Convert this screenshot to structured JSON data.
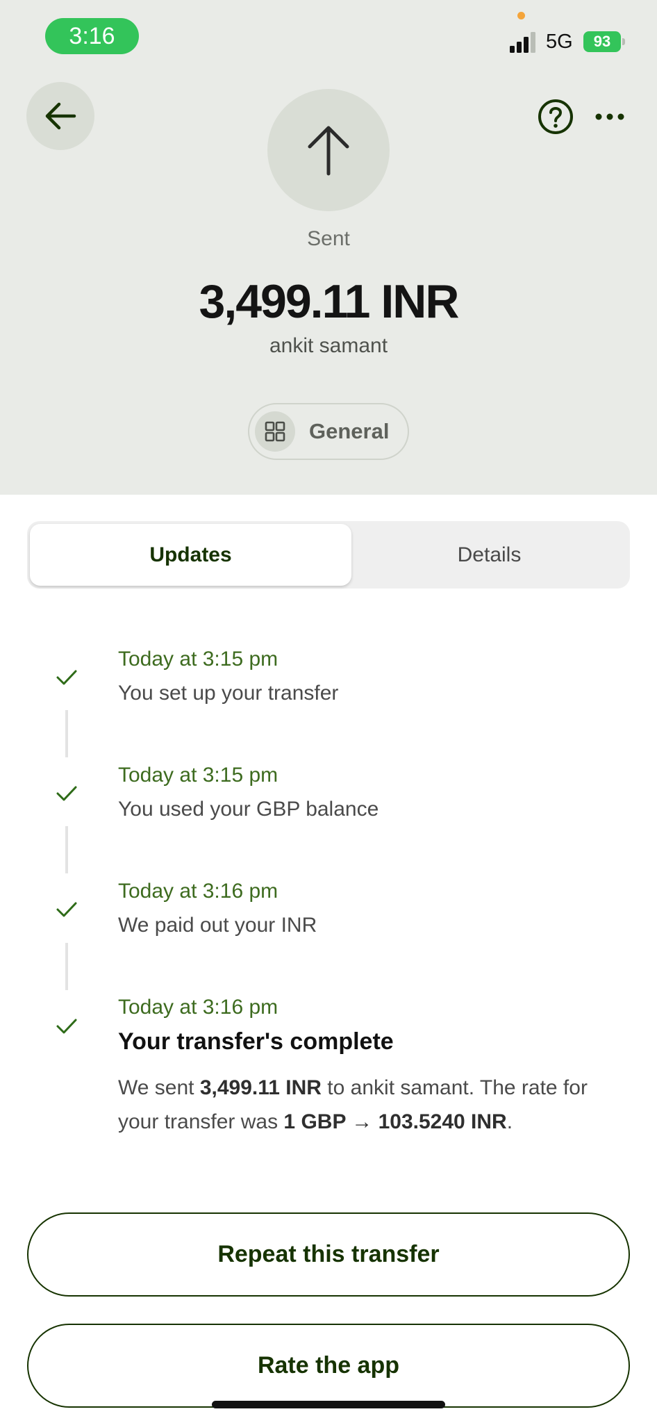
{
  "status_bar": {
    "time": "3:16",
    "network": "5G",
    "battery": "93"
  },
  "header": {
    "status_label": "Sent",
    "amount": "3,499.11 INR",
    "recipient": "ankit samant",
    "category": "General"
  },
  "icons": {
    "back": "arrow-left-icon",
    "help": "help-circle-icon",
    "more": "more-horizontal-icon",
    "sent": "arrow-up-icon",
    "category": "grid-icon",
    "step": "check-icon"
  },
  "tabs": [
    {
      "label": "Updates",
      "active": true
    },
    {
      "label": "Details",
      "active": false
    }
  ],
  "timeline": [
    {
      "time": "Today at 3:15 pm",
      "text": "You set up your transfer"
    },
    {
      "time": "Today at 3:15 pm",
      "text": "You used your GBP balance"
    },
    {
      "time": "Today at 3:16 pm",
      "text": "We paid out your INR"
    },
    {
      "time": "Today at 3:16 pm",
      "title": "Your transfer's complete",
      "desc": {
        "p1": "We sent ",
        "amount": "3,499.11 INR",
        "p2": " to ankit samant. The rate for your transfer was ",
        "rate": "1 GBP → 103.5240 INR",
        "p3": "."
      }
    }
  ],
  "actions": {
    "repeat": "Repeat this transfer",
    "rate": "Rate the app"
  },
  "colors": {
    "accent": "#163300",
    "time_green": "#3d6b1f",
    "header_bg": "#e9ebe7",
    "check_green": "#2e6b18"
  }
}
